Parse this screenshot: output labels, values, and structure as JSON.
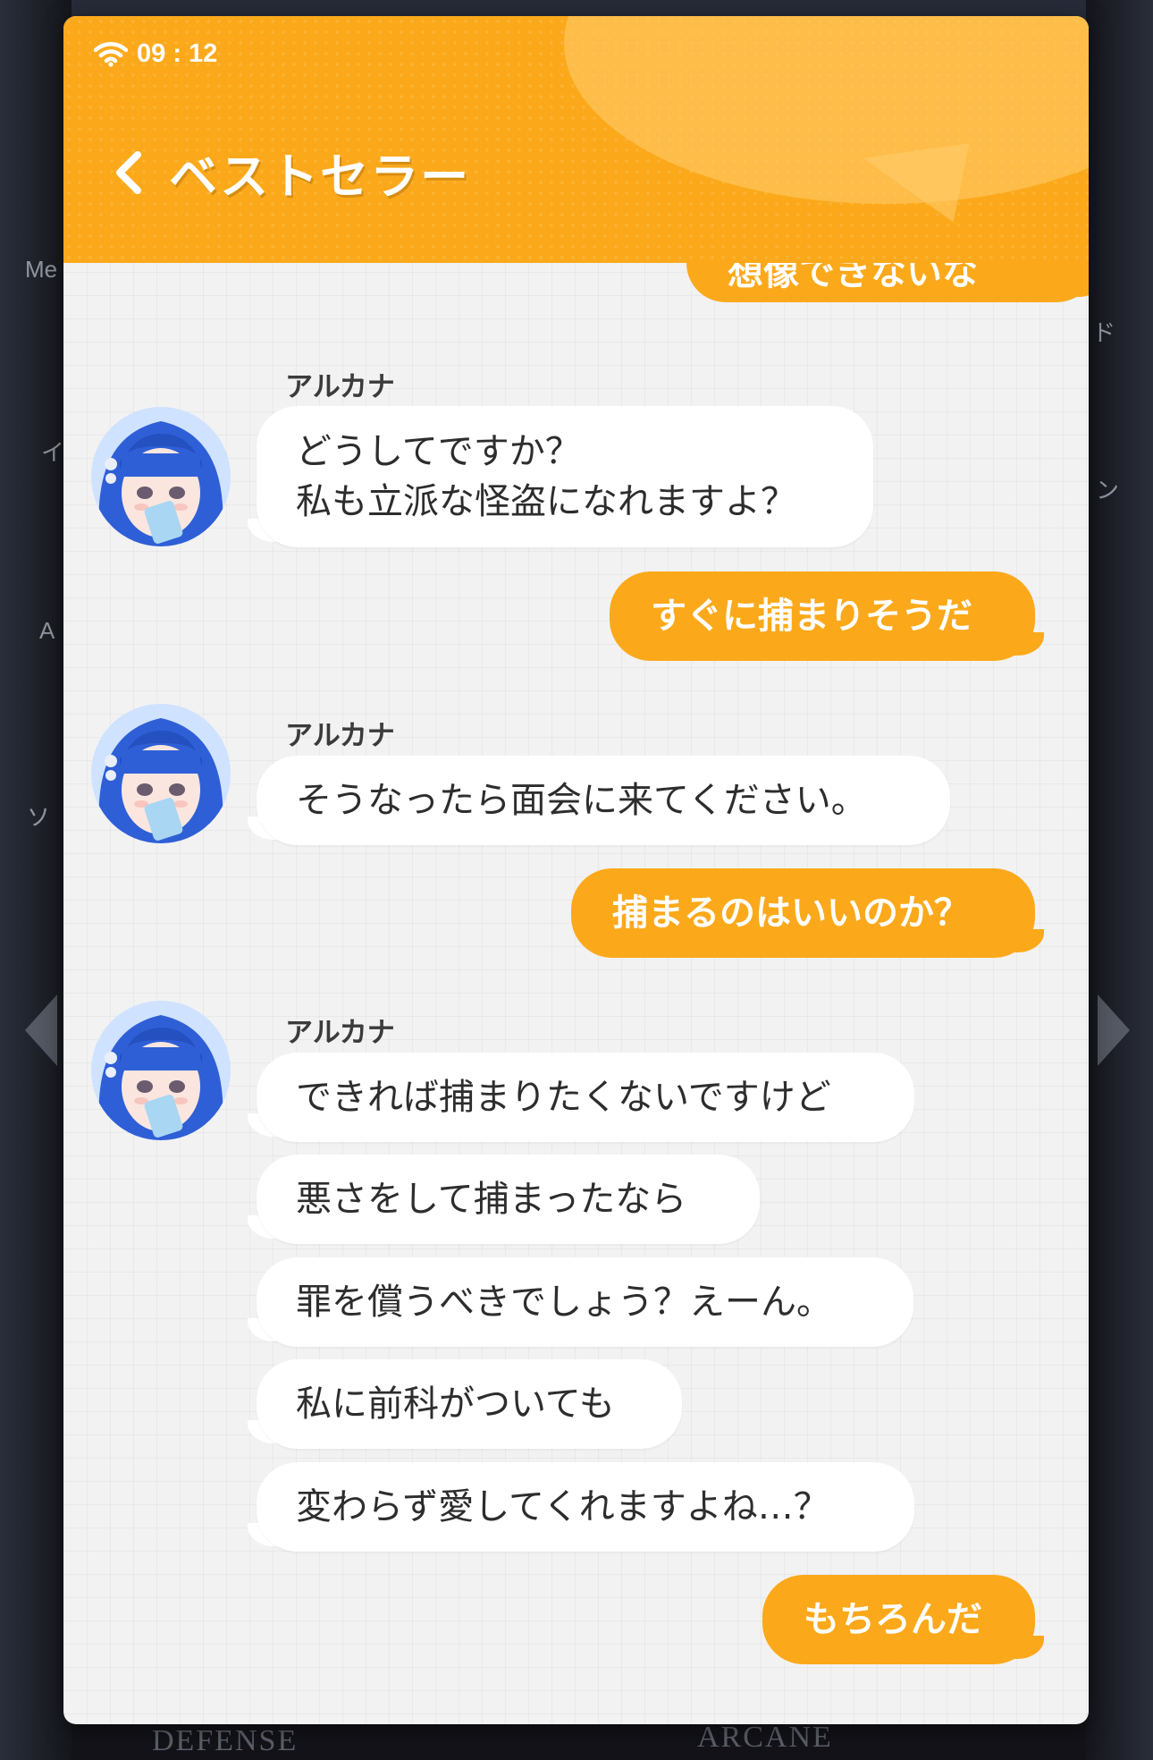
{
  "status_bar": {
    "time": "09 : 12",
    "icon": "wifi-icon"
  },
  "header": {
    "title": "ベストセラー",
    "back_icon": "chevron-left-icon"
  },
  "colors": {
    "accent": "#fba91b",
    "incoming_bubble": "#ffffff",
    "chat_background": "#f2f2f3",
    "avatar_hair": "#2f5fd6"
  },
  "background": {
    "side_labels": [
      "Me",
      "イ",
      "A",
      "ソ",
      "ド",
      "ン"
    ],
    "footer_labels": [
      "DEFENSE",
      "ARCANE"
    ]
  },
  "messages": {
    "m0": "想像できないな",
    "sender_1": "アルカナ",
    "m1_line1": "どうしてですか？",
    "m1_line2": "私も立派な怪盗になれますよ？",
    "m2": "すぐに捕まりそうだ",
    "sender_2": "アルカナ",
    "m3": "そうなったら面会に来てください。",
    "m4": "捕まるのはいいのか？",
    "sender_3": "アルカナ",
    "m5": "できれば捕まりたくないですけど",
    "m6": "悪さをして捕まったなら",
    "m7": "罪を償うべきでしょう？えーん。",
    "m8": "私に前科がついても",
    "m9": "変わらず愛してくれますよね…？",
    "m10": "もちろんだ"
  }
}
